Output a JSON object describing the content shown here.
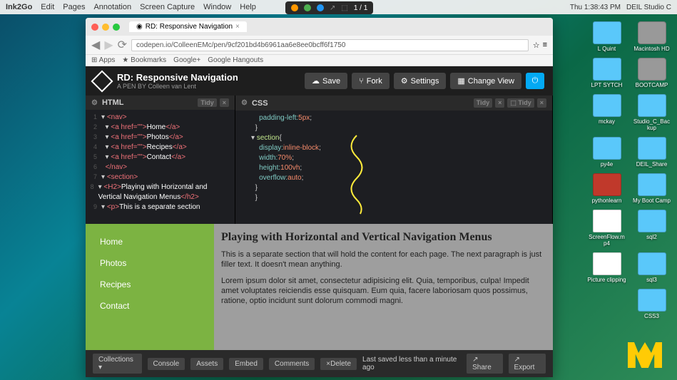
{
  "menubar": {
    "app": "Ink2Go",
    "items": [
      "Edit",
      "Pages",
      "Annotation",
      "Screen Capture",
      "Window",
      "Help"
    ],
    "right": {
      "time": "Thu 1:38:43 PM",
      "user": "DEIL Studio C"
    }
  },
  "toolbar": {
    "page": "1 / 1"
  },
  "browser": {
    "tab_title": "RD: Responsive Navigation",
    "url": "codepen.io/ColleenEMc/pen/9cf201bd4b6961aa6e8ee0bcff6f1750",
    "bookmarks": [
      "Apps",
      "Bookmarks",
      "Google+",
      "Google Hangouts"
    ]
  },
  "codepen": {
    "title": "RD: Responsive Navigation",
    "author": "A PEN BY Colleen van Lent",
    "buttons": {
      "save": "Save",
      "fork": "Fork",
      "settings": "Settings",
      "view": "Change View"
    }
  },
  "editor": {
    "html_label": "HTML",
    "css_label": "CSS",
    "tidy": "Tidy"
  },
  "html_code": {
    "l1": "<nav>",
    "l2a": "<a href=\"\">",
    "l2t": "Home",
    "l2b": "</a>",
    "l3a": "<a href=\"\">",
    "l3t": "Photos",
    "l3b": "</a>",
    "l4a": "<a href=\"\">",
    "l4t": "Recipes",
    "l4b": "</a>",
    "l5a": "<a href=\"\">",
    "l5t": "Contact",
    "l5b": "</a>",
    "l6": "</nav>",
    "l7": "<section>",
    "l8a": "<H2>",
    "l8t": "Playing with Horizontal and Vertical  Navigation Menus",
    "l8b": "</h2>",
    "l9a": "<p>",
    "l9t": "This is a separate section"
  },
  "css_code": {
    "l1a": "padding-left:",
    "l1b": "5px",
    "l1c": ";",
    "l2": "}",
    "l3": "section",
    "l3b": "{",
    "l4a": "display:",
    "l4b": "inline-block",
    "l4c": ";",
    "l5a": "width:",
    "l5b": "70%",
    "l5c": ";",
    "l6a": "height:",
    "l6b": "100vh",
    "l6c": ";",
    "l7a": "overflow:",
    "l7b": "auto",
    "l7c": ";",
    "l8": "}",
    "l9": "}"
  },
  "preview": {
    "nav": [
      "Home",
      "Photos",
      "Recipes",
      "Contact"
    ],
    "heading": "Playing with Horizontal and Vertical Navigation Menus",
    "p1": "This is a separate section that will hold the content for each page. The next paragraph is just filler text. It doesn't mean anything.",
    "p2": "Lorem ipsum dolor sit amet, consectetur adipisicing elit. Quia, temporibus, culpa! Impedit amet voluptates reiciendis esse quisquam. Eum quia, facere laboriosam quos possimus, ratione, optio incidunt sunt dolorum commodi magni."
  },
  "footer": {
    "collections": "Collections",
    "buttons": [
      "Console",
      "Assets",
      "Embed",
      "Comments",
      "×Delete"
    ],
    "status": "Last saved less than a minute ago",
    "share": "Share",
    "export": "Export"
  },
  "desktop": [
    {
      "l": "L Quint",
      "c": "folder"
    },
    {
      "l": "Macintosh HD",
      "c": "hd"
    },
    {
      "l": "LPT SYTCH",
      "c": "folder"
    },
    {
      "l": "BOOTCAMP",
      "c": "hd"
    },
    {
      "l": "mckay",
      "c": "folder"
    },
    {
      "l": "Studio_C_Backup",
      "c": "folder"
    },
    {
      "l": "py4e",
      "c": "folder"
    },
    {
      "l": "DEIL_Share",
      "c": "folder"
    },
    {
      "l": "pythonlearn",
      "c": "red"
    },
    {
      "l": "My Boot Camp",
      "c": "folder"
    },
    {
      "l": "ScreenFlow.mp4",
      "c": "file"
    },
    {
      "l": "sql2",
      "c": "folder"
    },
    {
      "l": "Picture clipping",
      "c": "file"
    },
    {
      "l": "sql3",
      "c": "folder"
    },
    {
      "l": "",
      "c": "none"
    },
    {
      "l": "CSS3",
      "c": "folder"
    }
  ]
}
